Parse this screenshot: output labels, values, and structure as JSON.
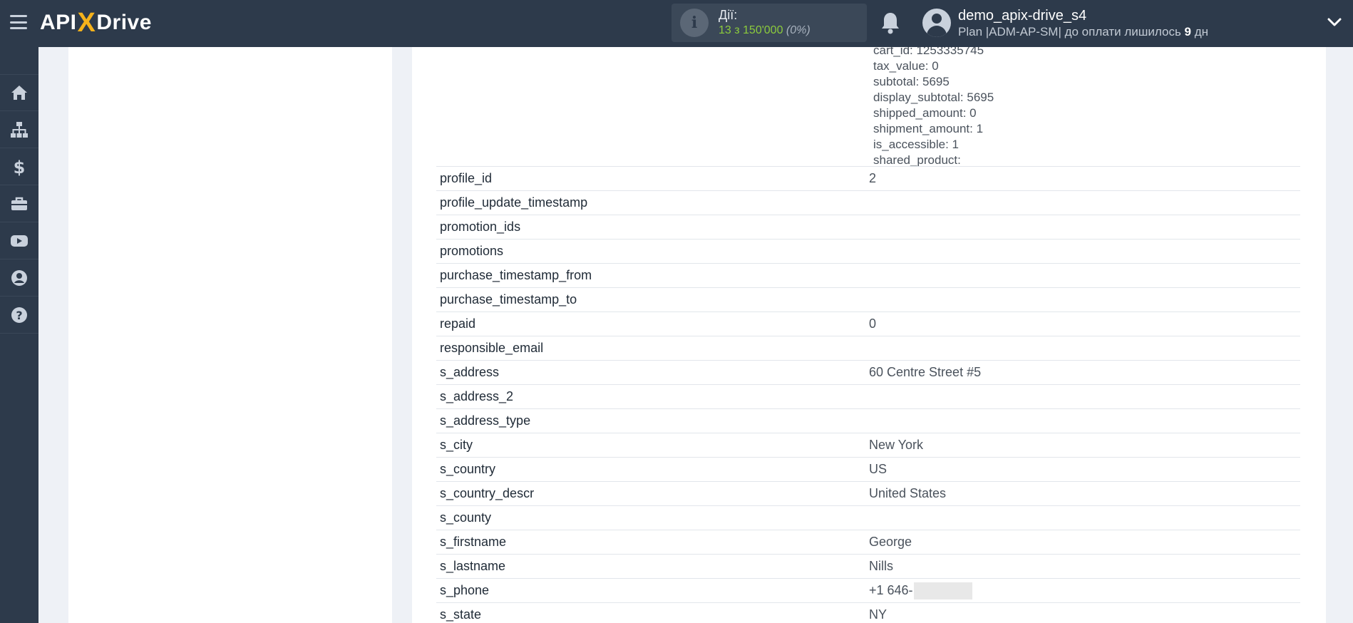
{
  "header": {
    "logo_api": "API",
    "logo_x": "X",
    "logo_drive": "Drive",
    "actions_label": "Дії:",
    "actions_count": "13 з 150'000",
    "actions_percent": "(0%)",
    "user_name": "demo_apix-drive_s4",
    "plan_prefix": "Plan |ADM-AP-SM| до оплати лишилось ",
    "plan_days": "9",
    "plan_suffix": " дн"
  },
  "sidebar": {
    "items": [
      {
        "icon": "home-icon"
      },
      {
        "icon": "sitemap-icon"
      },
      {
        "icon": "dollar-icon"
      },
      {
        "icon": "briefcase-icon"
      },
      {
        "icon": "youtube-icon"
      },
      {
        "icon": "user-circle-icon"
      },
      {
        "icon": "question-circle-icon"
      }
    ]
  },
  "nested_values": [
    "cart_id: 1253335745",
    "tax_value: 0",
    "subtotal: 5695",
    "display_subtotal: 5695",
    "shipped_amount: 0",
    "shipment_amount: 1",
    "is_accessible: 1",
    "shared_product:"
  ],
  "rows": [
    {
      "key": "profile_id",
      "value": "2"
    },
    {
      "key": "profile_update_timestamp",
      "value": ""
    },
    {
      "key": "promotion_ids",
      "value": ""
    },
    {
      "key": "promotions",
      "value": ""
    },
    {
      "key": "purchase_timestamp_from",
      "value": ""
    },
    {
      "key": "purchase_timestamp_to",
      "value": ""
    },
    {
      "key": "repaid",
      "value": "0"
    },
    {
      "key": "responsible_email",
      "value": ""
    },
    {
      "key": "s_address",
      "value": "60 Centre Street #5"
    },
    {
      "key": "s_address_2",
      "value": ""
    },
    {
      "key": "s_address_type",
      "value": ""
    },
    {
      "key": "s_city",
      "value": "New York"
    },
    {
      "key": "s_country",
      "value": "US"
    },
    {
      "key": "s_country_descr",
      "value": "United States"
    },
    {
      "key": "s_county",
      "value": ""
    },
    {
      "key": "s_firstname",
      "value": "George"
    },
    {
      "key": "s_lastname",
      "value": "Nills"
    },
    {
      "key": "s_phone",
      "value": "+1 646-",
      "redacted": true
    },
    {
      "key": "s_state",
      "value": "NY"
    }
  ],
  "colors": {
    "topbar": "#2d3a4b",
    "accent_green": "#8ccb3c",
    "logo_x": "#f5b21b",
    "background": "#eef1f6"
  }
}
